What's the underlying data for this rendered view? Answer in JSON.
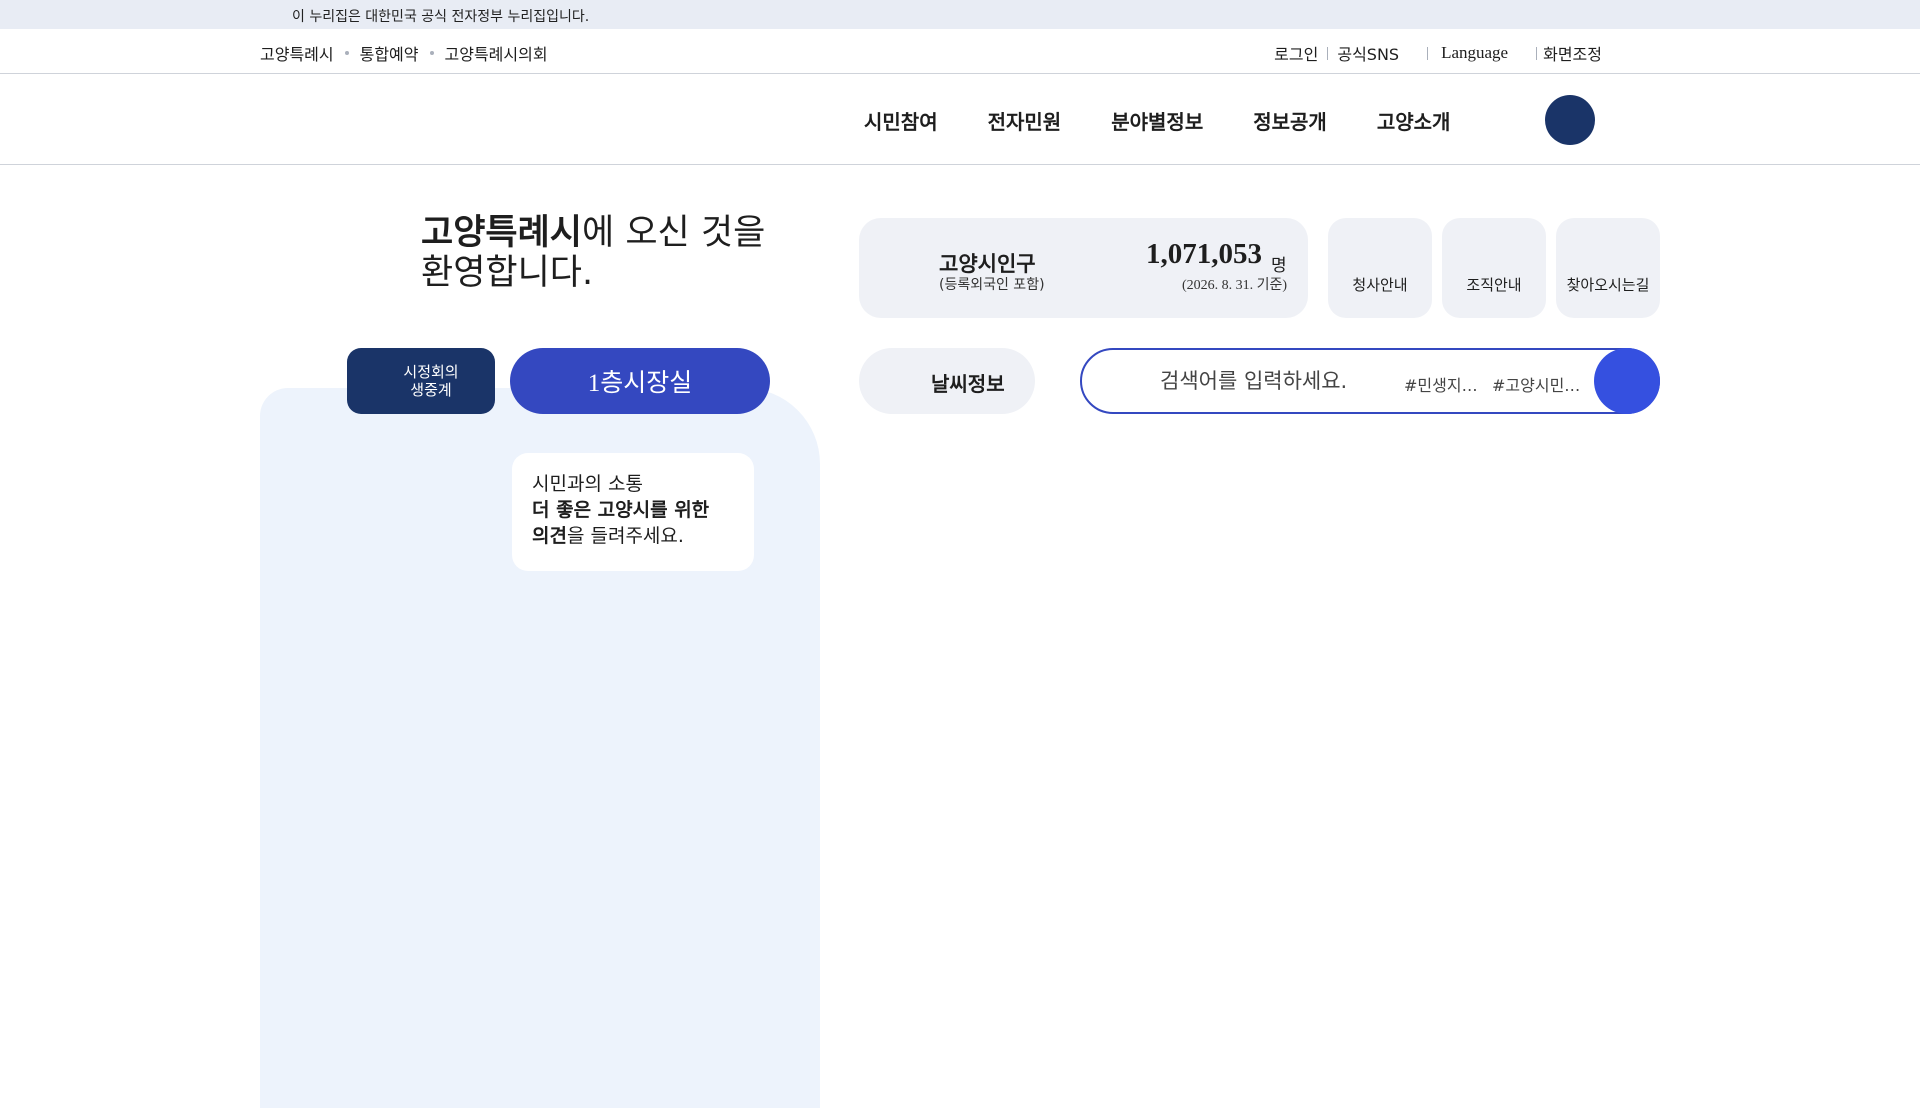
{
  "gov_banner": {
    "text": "이 누리집은 대한민국 공식 전자정부 누리집입니다."
  },
  "utility": {
    "left_links": [
      "고양특례시",
      "통합예약",
      "고양특례시의회"
    ],
    "right_links": {
      "login": "로그인",
      "sns": "공식SNS",
      "language": "Language",
      "zoom": "화면조정"
    }
  },
  "gnb": {
    "menu": [
      "시민참여",
      "전자민원",
      "분야별정보",
      "정보공개",
      "고양소개"
    ]
  },
  "welcome": {
    "bold": "고양특례시",
    "rest_line1": "에 오신 것을",
    "line2": "환영합니다."
  },
  "live_tabs": {
    "council_l1": "시정회의",
    "council_l2": "생중계",
    "room": "1층시장실"
  },
  "bubble": {
    "line1": "시민과의 소통",
    "bold_l2": "더 좋은 고양시를 위한",
    "bold_l3": "의견",
    "rest_l3": "을 들려주세요."
  },
  "population": {
    "title": "고양시인구",
    "subtitle": "(등록외국인 포함)",
    "value": "1,071,053",
    "unit": "명",
    "date": "(2026. 8. 31. 기준)"
  },
  "quick_links": [
    "청사안내",
    "조직안내",
    "찾아오시는길"
  ],
  "weather": {
    "label": "날씨정보"
  },
  "search": {
    "placeholder": "검색어를 입력하세요.",
    "tags": [
      "#민생지…",
      "#고양시민…"
    ]
  },
  "colors": {
    "navy": "#1a3468",
    "blue": "#3448c0",
    "search_blue": "#3550e0",
    "panel": "#edf3fc",
    "card": "#eff1f6"
  }
}
